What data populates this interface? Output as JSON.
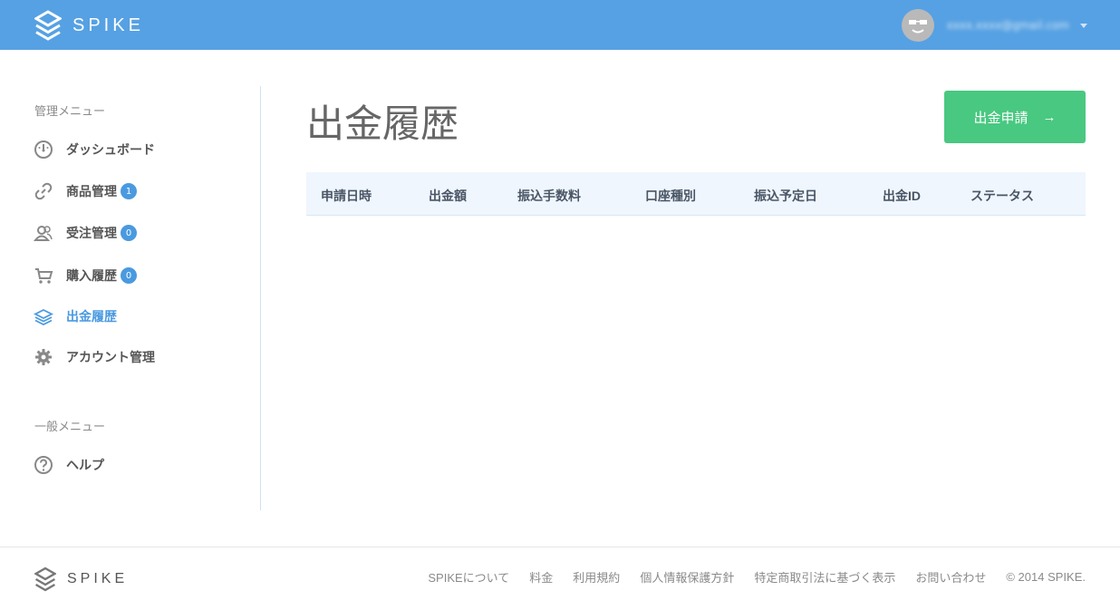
{
  "header": {
    "logo_text": "SPIKE",
    "user_email": "xxxx.xxxx@gmail.com"
  },
  "sidebar": {
    "admin_menu_label": "管理メニュー",
    "general_menu_label": "一般メニュー",
    "items": [
      {
        "label": "ダッシュボード",
        "icon": "dashboard-icon"
      },
      {
        "label": "商品管理",
        "icon": "link-icon",
        "badge": "1"
      },
      {
        "label": "受注管理",
        "icon": "users-icon",
        "badge": "0"
      },
      {
        "label": "購入履歴",
        "icon": "cart-icon",
        "badge": "0"
      },
      {
        "label": "出金履歴",
        "icon": "layers-icon",
        "active": true
      },
      {
        "label": "アカウント管理",
        "icon": "gear-icon"
      }
    ],
    "help_label": "ヘルプ"
  },
  "main": {
    "title": "出金履歴",
    "withdraw_button": "出金申請",
    "withdraw_arrow": "→",
    "columns": [
      "申請日時",
      "出金額",
      "振込手数料",
      "口座種別",
      "振込予定日",
      "出金ID",
      "ステータス"
    ]
  },
  "footer": {
    "logo_text": "SPIKE",
    "links": [
      "SPIKEについて",
      "料金",
      "利用規約",
      "個人情報保護方針",
      "特定商取引法に基づく表示",
      "お問い合わせ"
    ],
    "copyright": "© 2014 SPIKE."
  },
  "colors": {
    "header_bg": "#56a1e3",
    "accent": "#4a9ae0",
    "button_green": "#49c881",
    "table_header_bg": "#eff6fd"
  }
}
